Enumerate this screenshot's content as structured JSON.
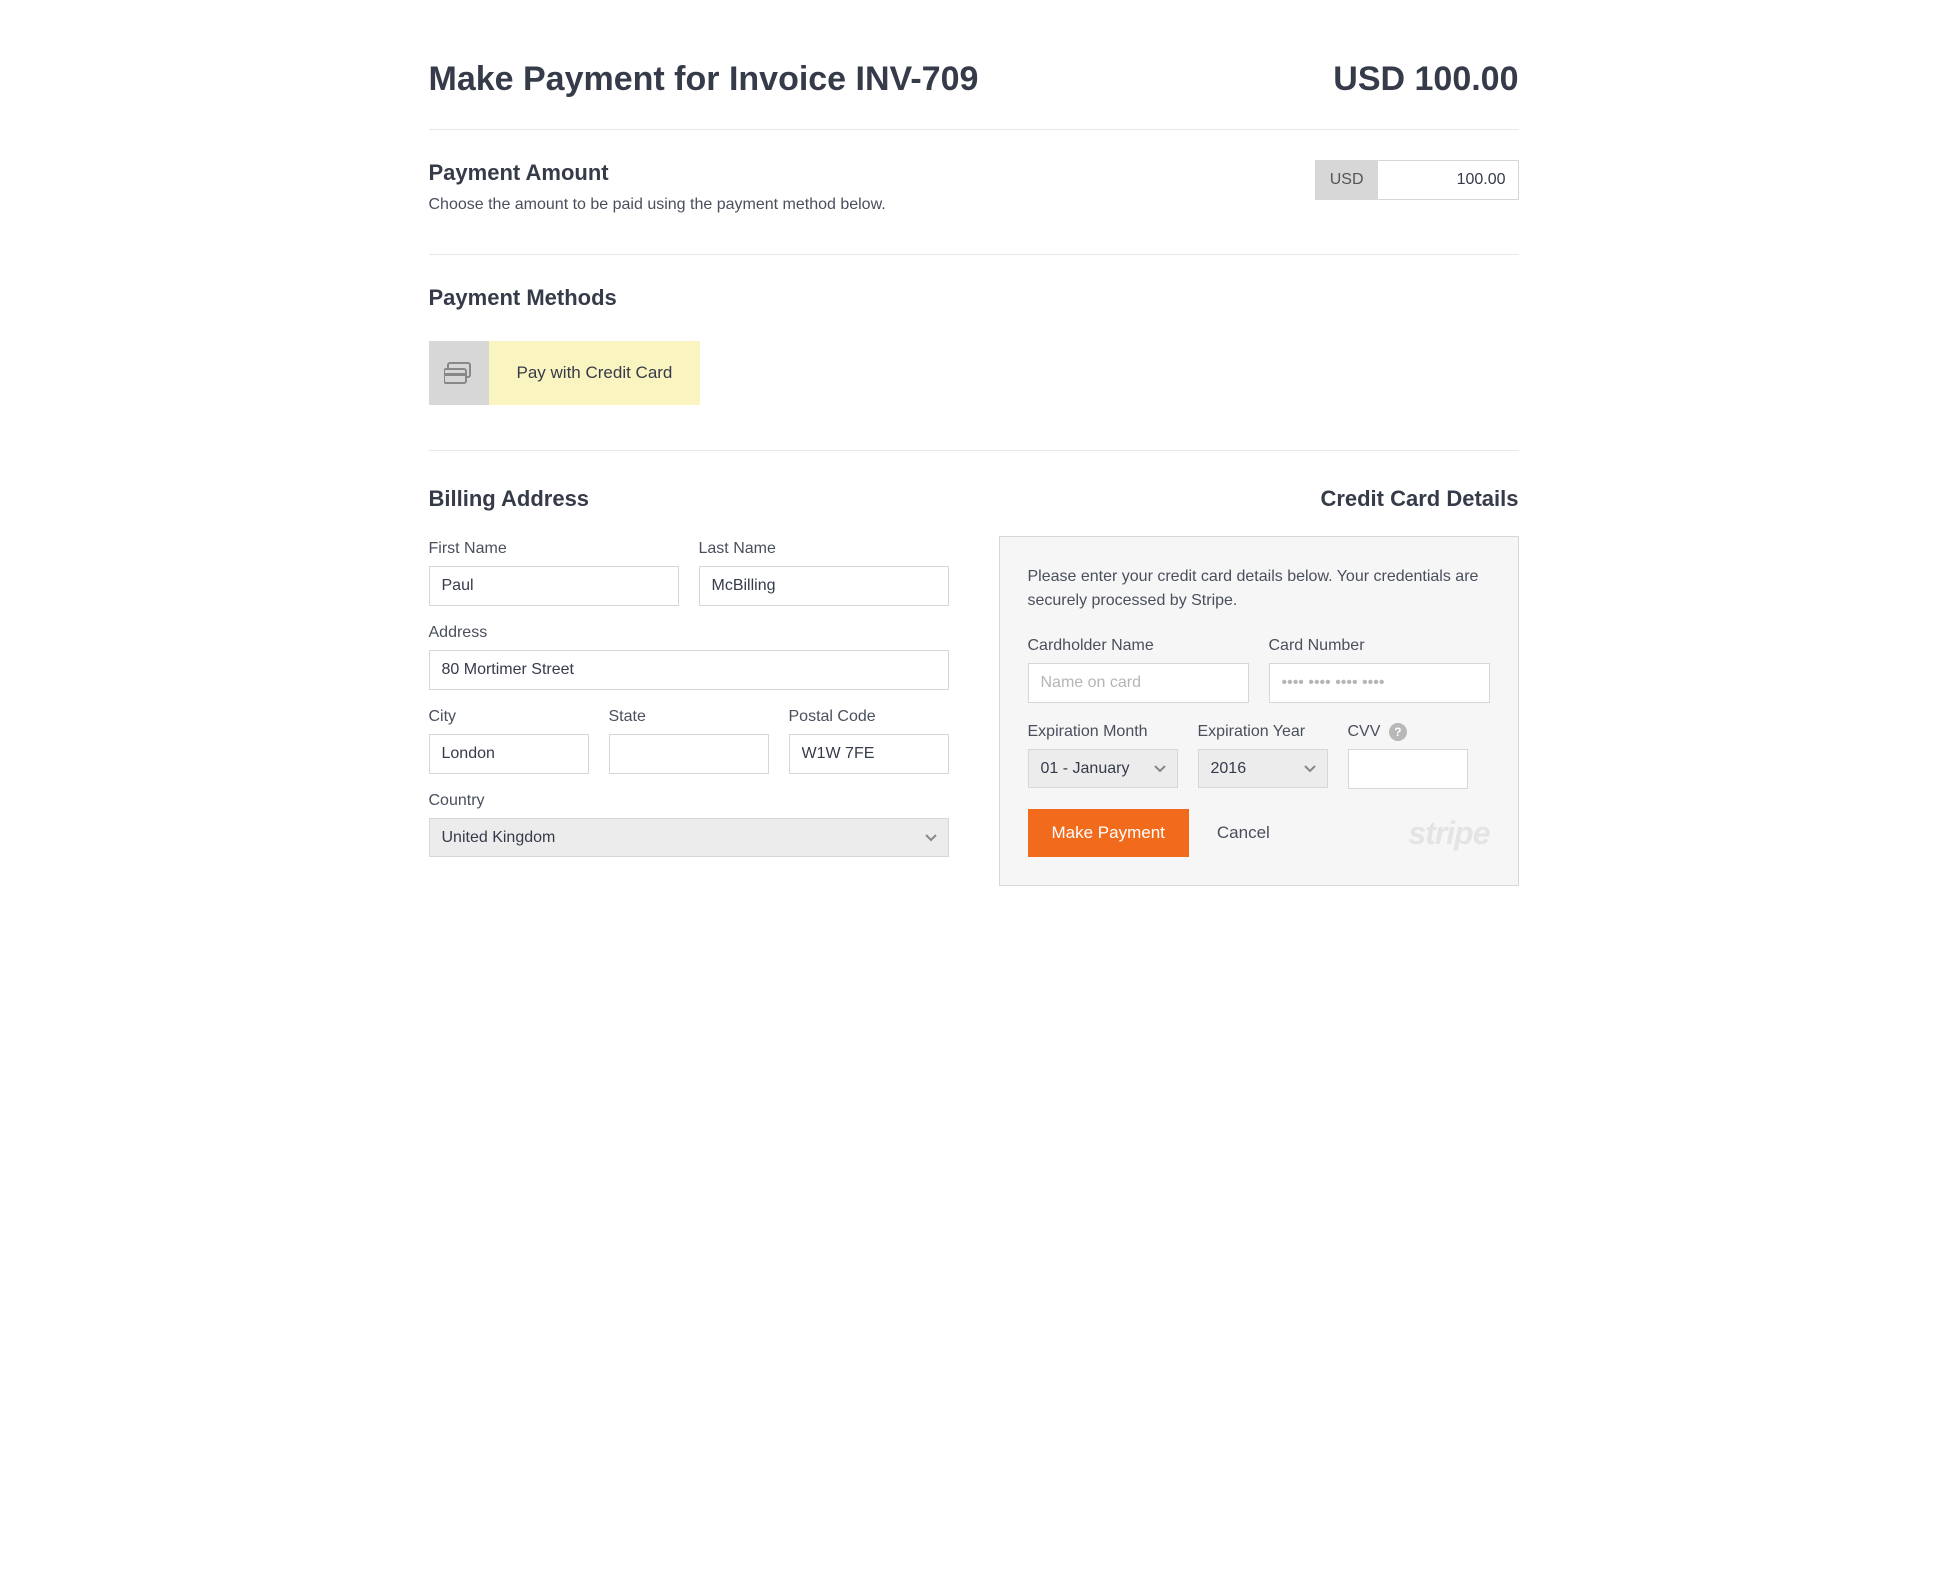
{
  "header": {
    "title": "Make Payment for Invoice INV-709",
    "amount": "USD 100.00"
  },
  "payment_amount": {
    "title": "Payment Amount",
    "description": "Choose the amount to be paid using the payment method below.",
    "currency": "USD",
    "value": "100.00"
  },
  "payment_methods": {
    "title": "Payment Methods",
    "credit_card_label": "Pay with Credit Card"
  },
  "billing": {
    "title": "Billing Address",
    "first_name_label": "First Name",
    "first_name": "Paul",
    "last_name_label": "Last Name",
    "last_name": "McBilling",
    "address_label": "Address",
    "address": "80 Mortimer Street",
    "city_label": "City",
    "city": "London",
    "state_label": "State",
    "state": "",
    "postal_label": "Postal Code",
    "postal": "W1W 7FE",
    "country_label": "Country",
    "country": "United Kingdom"
  },
  "cc": {
    "title": "Credit Card Details",
    "description": "Please enter your credit card details below. Your credentials are securely processed by Stripe.",
    "cardholder_label": "Cardholder Name",
    "cardholder_placeholder": "Name on card",
    "number_label": "Card Number",
    "number_placeholder": "•••• •••• •••• ••••",
    "exp_month_label": "Expiration Month",
    "exp_month": "01 - January",
    "exp_year_label": "Expiration Year",
    "exp_year": "2016",
    "cvv_label": "CVV",
    "submit_label": "Make Payment",
    "cancel_label": "Cancel",
    "processor": "stripe"
  }
}
